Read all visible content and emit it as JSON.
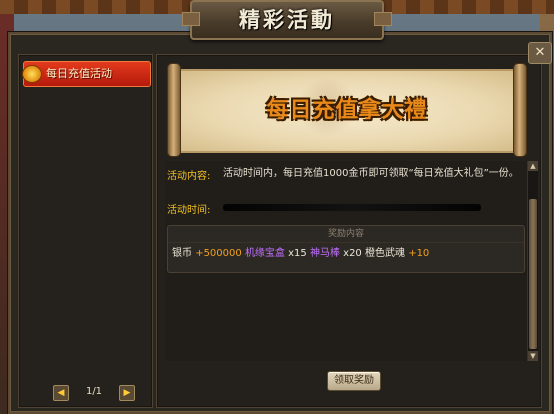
{
  "window": {
    "title": "精彩活動",
    "close_label": "✕"
  },
  "sidebar": {
    "items": [
      {
        "label": "每日充值活动",
        "selected": true
      }
    ],
    "pager": {
      "prev_icon": "◀",
      "next_icon": "▶",
      "text": "1/1"
    }
  },
  "banner": {
    "title": "每日充值拿大禮"
  },
  "details": {
    "content_label": "活动内容:",
    "content_text": "活动时间内，每日充值1000金币即可领取“每日充值大礼包”一份。",
    "time_label": "活动时间:",
    "time_value_redacted": true
  },
  "rewards": {
    "header": "奖励内容",
    "items": [
      {
        "name": "银币",
        "amount": "+500000",
        "color": "#f0a020"
      },
      {
        "name": "机缘宝盒",
        "amount": "x15",
        "color": "#c070ff"
      },
      {
        "name": "神马棒",
        "amount": "x20",
        "color": "#c070ff"
      },
      {
        "name": "橙色武魂",
        "amount": "+10",
        "color": "#f0a020"
      }
    ]
  },
  "actions": {
    "claim_label": "领取奖励"
  },
  "scrollbar": {
    "up_icon": "▲",
    "down_icon": "▼"
  },
  "colors": {
    "accent_label": "#f0c020",
    "selected_item": "#d42a14",
    "banner_text": "#e8891a"
  }
}
